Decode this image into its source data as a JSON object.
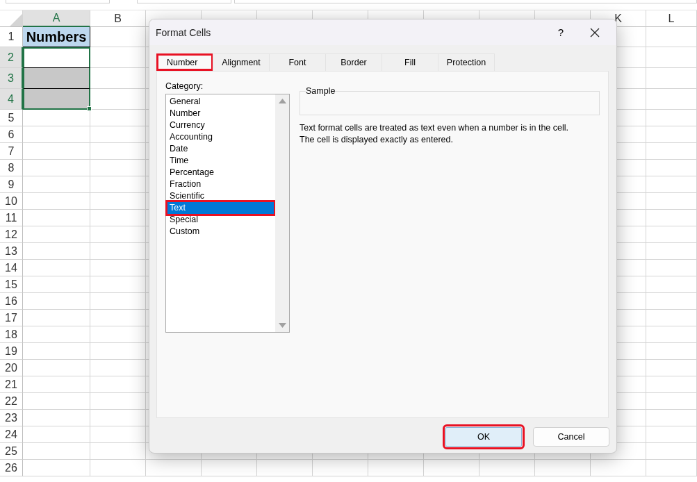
{
  "sheet": {
    "columns": [
      {
        "label": "A",
        "selected": true
      },
      {
        "label": "B",
        "selected": false
      },
      {
        "selected": false
      },
      {
        "selected": false
      },
      {
        "selected": false
      },
      {
        "selected": false
      },
      {
        "selected": false
      },
      {
        "selected": false
      },
      {
        "selected": false
      },
      {
        "selected": false
      },
      {
        "label": "K",
        "selected": false
      },
      {
        "label": "L",
        "selected": false
      }
    ],
    "rows": [
      {
        "label": "1",
        "selected": false,
        "cell": {
          "text": "Numbers",
          "color": "#bdd7ee"
        }
      },
      {
        "label": "2",
        "selected": true,
        "cell": {
          "color": "#ffffff"
        }
      },
      {
        "label": "3",
        "selected": true,
        "cell": {
          "color": "#c8c8c8"
        }
      },
      {
        "label": "4",
        "selected": true,
        "cell": {
          "color": "#c8c8c8"
        }
      },
      {
        "label": "5",
        "selected": false
      },
      {
        "label": "6",
        "selected": false
      },
      {
        "label": "7",
        "selected": false
      },
      {
        "label": "8",
        "selected": false
      },
      {
        "label": "9",
        "selected": false
      },
      {
        "label": "10",
        "selected": false
      },
      {
        "label": "11",
        "selected": false
      },
      {
        "label": "12",
        "selected": false
      },
      {
        "label": "13",
        "selected": false
      },
      {
        "label": "14",
        "selected": false
      },
      {
        "label": "15",
        "selected": false
      },
      {
        "label": "16",
        "selected": false
      },
      {
        "label": "17",
        "selected": false
      },
      {
        "label": "18",
        "selected": false
      },
      {
        "label": "19",
        "selected": false
      },
      {
        "label": "20",
        "selected": false
      },
      {
        "label": "21",
        "selected": false
      },
      {
        "label": "22",
        "selected": false
      },
      {
        "label": "23",
        "selected": false
      },
      {
        "label": "24",
        "selected": false
      },
      {
        "label": "25",
        "selected": false
      },
      {
        "label": "26",
        "selected": false
      }
    ]
  },
  "dialog": {
    "title": "Format Cells",
    "help": "?",
    "tabs": [
      {
        "label": "Number",
        "selected": true,
        "highlighted": true
      },
      {
        "label": "Alignment",
        "selected": false,
        "highlighted": false
      },
      {
        "label": "Font",
        "selected": false,
        "highlighted": false
      },
      {
        "label": "Border",
        "selected": false,
        "highlighted": false
      },
      {
        "label": "Fill",
        "selected": false,
        "highlighted": false
      },
      {
        "label": "Protection",
        "selected": false,
        "highlighted": false
      }
    ],
    "category_label": "Category:",
    "categories": [
      {
        "label": "General",
        "selected": false,
        "highlighted": false
      },
      {
        "label": "Number",
        "selected": false,
        "highlighted": false
      },
      {
        "label": "Currency",
        "selected": false,
        "highlighted": false
      },
      {
        "label": "Accounting",
        "selected": false,
        "highlighted": false
      },
      {
        "label": "Date",
        "selected": false,
        "highlighted": false
      },
      {
        "label": "Time",
        "selected": false,
        "highlighted": false
      },
      {
        "label": "Percentage",
        "selected": false,
        "highlighted": false
      },
      {
        "label": "Fraction",
        "selected": false,
        "highlighted": false
      },
      {
        "label": "Scientific",
        "selected": false,
        "highlighted": false
      },
      {
        "label": "Text",
        "selected": true,
        "highlighted": true
      },
      {
        "label": "Special",
        "selected": false,
        "highlighted": false
      },
      {
        "label": "Custom",
        "selected": false,
        "highlighted": false
      }
    ],
    "sample_label": "Sample",
    "description": [
      "Text format cells are treated as text even when a number is in the cell.",
      "The cell is displayed exactly as entered."
    ],
    "buttons": [
      {
        "label": "OK",
        "default": true,
        "highlighted": true
      },
      {
        "label": "Cancel",
        "default": false,
        "highlighted": false
      }
    ]
  }
}
